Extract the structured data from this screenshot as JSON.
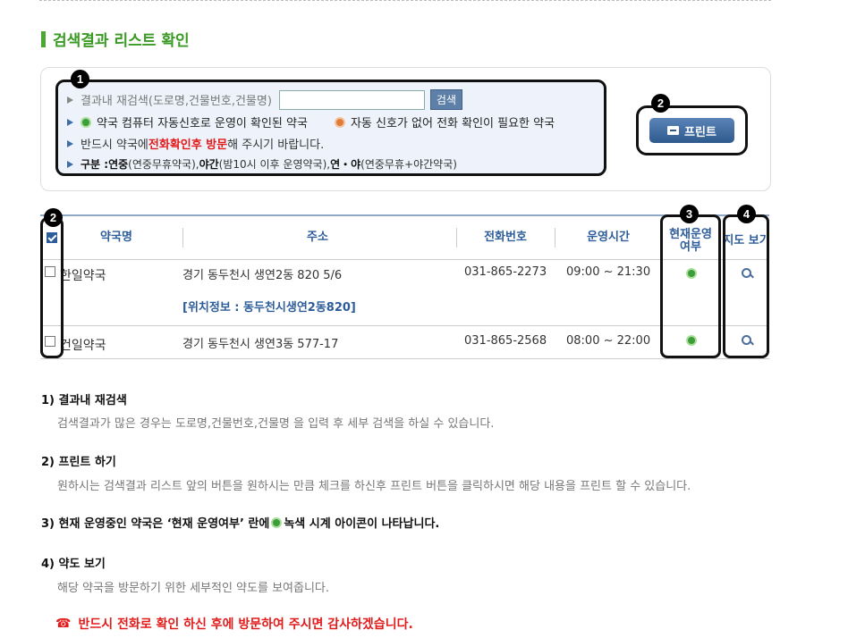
{
  "section_title": "검색결과 리스트 확인",
  "badges": {
    "b1": "1",
    "b2": "2",
    "b3": "3",
    "b4": "4"
  },
  "info": {
    "research_label": "결과내 재검색(도로명,건물번호,건물명)",
    "research_input_value": "",
    "search_button": "검색",
    "legend_green": "약국 컴퓨터 자동신호로 운영이 확인된 약국",
    "legend_orange": "자동 신호가 없어 전화 확인이 필요한 약국",
    "notice_prefix": "반드시 약국에 ",
    "notice_red": "전화확인후 방문",
    "notice_suffix": "해 주시기 바랍니다.",
    "category_label": "구분 : ",
    "cat1_bold": "연중",
    "cat1_desc": "(연중무휴약국), ",
    "cat2_bold": "야간",
    "cat2_desc": "(밤10시 이후 운영약국), ",
    "cat3_bold": "연・야",
    "cat3_desc": "(연중무휴+야간약국)"
  },
  "print_button": "프린트",
  "table": {
    "headers": {
      "name": "약국명",
      "address": "주소",
      "phone": "전화번호",
      "hours": "운영시간",
      "status": "현재운영 여부",
      "map": "지도 보기"
    },
    "rows": [
      {
        "name": "한일약국",
        "address": "경기 동두천시 생연2동 820 5/6",
        "phone": "031-865-2273",
        "hours": "09:00 ~ 21:30"
      },
      {
        "name": "건일약국",
        "address": "경기 동두천시 생연3동 577-17",
        "phone": "031-865-2568",
        "hours": "08:00 ~ 22:00"
      }
    ],
    "location_info": "[위치정보 : 동두천시생연2동820]"
  },
  "notes": [
    {
      "title": "1) 결과내 재검색",
      "body": "검색결과가 많은 경우는 도로명,건물번호,건물명 을 입력 후 세부 검색을 하실 수 있습니다."
    },
    {
      "title": "2) 프린트 하기",
      "body": "원하시는 검색결과 리스트 앞의 버튼을 원하시는 만큼 체크를 하신후 프린트 버튼을 클릭하시면 해당 내용을 프린트 할 수 있습니다."
    },
    {
      "title_prefix": "3) 현재 운영중인 약국은 ‘현재 운영여부’ 란에 ",
      "title_suffix": " 녹색 시계 아이콘이 나타납니다."
    },
    {
      "title": "4) 약도 보기",
      "body": "해당 약국을 방문하기 위한 세부적인 약도를 보여줍니다."
    }
  ],
  "footer": "반드시 전화로 확인 하신 후에 방문하여 주시면 감사하겠습니다.",
  "colors": {
    "accent_green": "#3a9a23",
    "header_blue": "#2d5c9a",
    "alert_red": "#e21b1b"
  }
}
